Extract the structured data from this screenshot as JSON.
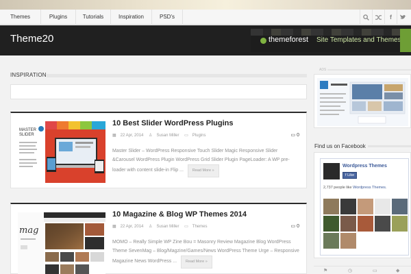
{
  "nav": {
    "items": [
      "Themes",
      "Plugins",
      "Tutorials",
      "Inspiration",
      "PSD's"
    ],
    "icons": [
      "search-icon",
      "shuffle-icon",
      "facebook-icon",
      "twitter-icon"
    ]
  },
  "header": {
    "logo": "Theme20",
    "banner": {
      "brand": "themeforest",
      "tagline": "Site Templates and Themes"
    }
  },
  "main": {
    "section_title": "INSPIRATION",
    "posts": [
      {
        "title": "10 Best Slider WordPress Plugins",
        "date": "22 Apr, 2014",
        "author": "Susan Miller",
        "category": "Plugins",
        "comments": "0",
        "excerpt": "Master Slider – WordPress Responsive Touch Slider   Magic Responsive Slider &Carousel WordPress Plugin WordPress Grid Slider Plugin    PageLoader: A WP pre-loader with content slide-in Flip ...",
        "read_more": "Read More »"
      },
      {
        "title": "10 Magazine & Blog WP Themes 2014",
        "date": "22 Apr, 2014",
        "author": "Susan Miller",
        "category": "Themes",
        "comments": "0",
        "excerpt": "MOMO – Really Simple WP Zine   Bou = Masonry Review Magazine Blog WordPress Theme   SevenMag – Blog/Magzine/Games/News WordPress Theme   Urge – Responsive Magazine News WordPress ...",
        "read_more": "Read More »"
      }
    ]
  },
  "sidebar": {
    "ads_label": "ADS",
    "facebook": {
      "title": "Find us on Facebook",
      "page_name": "Wordpress Themes",
      "like_label": "Like",
      "count_text": "2,737 people like",
      "count_link": "Wordpress Themes."
    }
  },
  "colors": {
    "header_bg": "#202020",
    "facebook_blue": "#3b5998",
    "themeforest_green": "#7fb241"
  }
}
